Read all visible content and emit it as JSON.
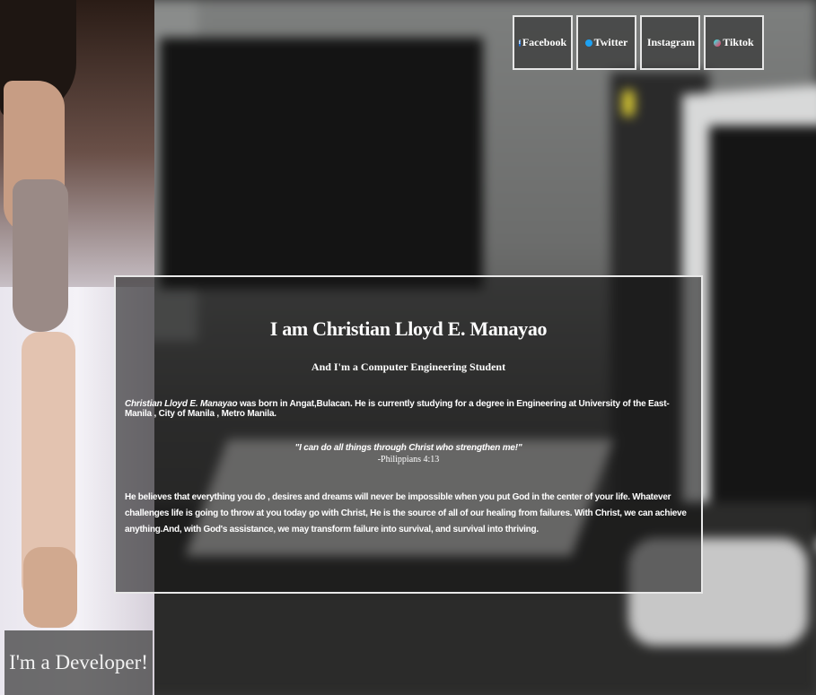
{
  "social": {
    "facebook": {
      "label": "Facebook",
      "icon": "facebook-icon"
    },
    "twitter": {
      "label": "Twitter",
      "icon": "twitter-icon"
    },
    "instagram": {
      "label": "Instagram",
      "icon": "instagram-icon"
    },
    "tiktok": {
      "label": "Tiktok",
      "icon": "tiktok-icon"
    }
  },
  "bio": {
    "heading": "I am Christian Lloyd E. Manayao",
    "subheading": "And I'm a Computer Engineering Student",
    "name_italic": "Christian Lloyd E. Manayao",
    "intro_rest": " was born in Angat,Bulacan. He is currently studying for a degree in Engineering at University of the East-Manila , City of Manila , Metro Manila.",
    "quote": "\"I can do all things through Christ who strengthen me!\"",
    "quote_ref": "-Philippians 4:13",
    "body": "He believes that everything you do , desires and dreams will never be impossible when you put God in the center of your life. Whatever challenges life is going to throw at you today go with Christ, He is the source of all of our healing from failures. With Christ, we can achieve anything.And, with God's assistance, we may transform failure into survival, and survival into thriving."
  },
  "portrait": {
    "caption": "I'm a Developer!"
  },
  "colors": {
    "facebook": "#1877f2",
    "twitter": "#1da1f2",
    "card_border": "#e8e8e8",
    "text": "#ffffff"
  }
}
